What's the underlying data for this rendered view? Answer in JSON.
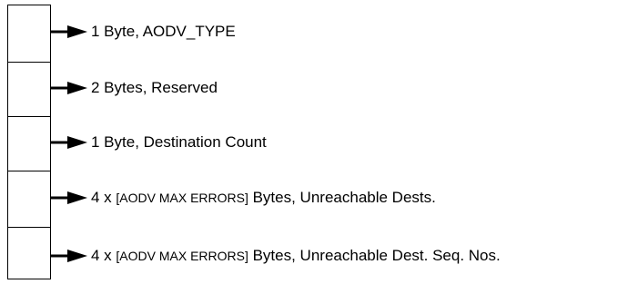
{
  "fields": [
    {
      "label": "1 Byte, AODV_TYPE"
    },
    {
      "label": "2 Bytes, Reserved"
    },
    {
      "label": "1 Byte, Destination Count"
    },
    {
      "label_prefix": "4 x ",
      "label_bracket": "[AODV MAX ERRORS]",
      "label_suffix": " Bytes, Unreachable Dests."
    },
    {
      "label_prefix": "4 x ",
      "label_bracket": "[AODV MAX ERRORS]",
      "label_suffix": " Bytes, Unreachable Dest. Seq. Nos."
    }
  ],
  "colors": {
    "line": "#000000",
    "background": "#ffffff"
  }
}
